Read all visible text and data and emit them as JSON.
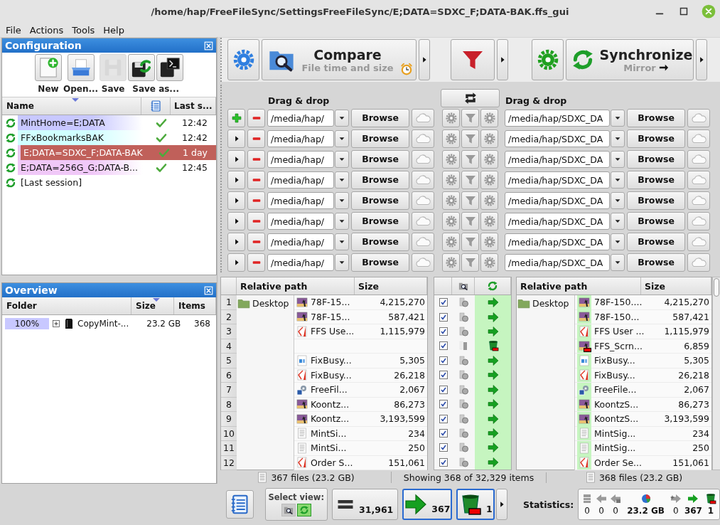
{
  "window": {
    "title": "/home/hap/FreeFileSync/SettingsFreeFileSync/E;DATA=SDXC_F;DATA-BAK.ffs_gui"
  },
  "menu": [
    "File",
    "Actions",
    "Tools",
    "Help"
  ],
  "configuration": {
    "title": "Configuration",
    "toolbar": [
      {
        "label": "New",
        "buttons": [
          {
            "kind": "new",
            "disabled": false
          }
        ]
      },
      {
        "label": "Open...",
        "buttons": [
          {
            "kind": "open",
            "disabled": false
          }
        ]
      },
      {
        "label": "Save",
        "buttons": [
          {
            "kind": "save",
            "disabled": true
          }
        ]
      },
      {
        "label": "Save as...",
        "buttons": [
          {
            "kind": "save-as",
            "disabled": false
          },
          {
            "kind": "save-batch",
            "disabled": false
          }
        ]
      }
    ],
    "columns": {
      "name": "Name",
      "last_sync": "Last s..."
    },
    "rows": [
      {
        "name": "MintHome=E;DATA",
        "ok": true,
        "last_sync": "12:42",
        "color": "#c8c8ff",
        "selected": false
      },
      {
        "name": "FFxBookmarksBAK",
        "ok": true,
        "last_sync": "12:42",
        "color": "#d0ffff",
        "selected": false
      },
      {
        "name": "E;DATA=SDXC_F;DATA-BAK",
        "ok": true,
        "last_sync": "1 day",
        "color": "#e8c8f0",
        "selected": true
      },
      {
        "name": "E;DATA=256G_G;DATA-B...",
        "ok": true,
        "last_sync": "12:45",
        "color": "#f0c8f8",
        "selected": false
      },
      {
        "name": "[Last session]",
        "ok": false,
        "selected": false
      }
    ]
  },
  "overview": {
    "title": "Overview",
    "columns": [
      "Folder",
      "Size",
      "Items"
    ],
    "rows": [
      {
        "percent": "100%",
        "level": 1,
        "expanded": false,
        "name": "CopyMint-...",
        "size": "23.2 GB",
        "items": "368"
      }
    ]
  },
  "toolbar": {
    "compare": {
      "title": "Compare",
      "subtitle": "File time and size"
    },
    "synchronize": {
      "title": "Synchronize",
      "subtitle": "Mirror"
    }
  },
  "folder_pairs": {
    "left_label": "Drag & drop",
    "right_label": "Drag & drop",
    "rows": [
      {
        "kind": "main",
        "left_path": "/media/hap/",
        "left_browse": "Browse",
        "right_path": "/media/hap/SDXC_DA",
        "right_browse": "Browse"
      },
      {
        "kind": "extra",
        "left_path": "/media/hap/",
        "left_browse": "Browse",
        "right_path": "/media/hap/SDXC_DA",
        "right_browse": "Browse"
      },
      {
        "kind": "extra",
        "left_path": "/media/hap/",
        "left_browse": "Browse",
        "right_path": "/media/hap/SDXC_DA",
        "right_browse": "Browse"
      },
      {
        "kind": "extra",
        "left_path": "/media/hap/",
        "left_browse": "Browse",
        "right_path": "/media/hap/SDXC_DA",
        "right_browse": "Browse"
      },
      {
        "kind": "extra",
        "left_path": "/media/hap/",
        "left_browse": "Browse",
        "right_path": "/media/hap/SDXC_DA",
        "right_browse": "Browse"
      },
      {
        "kind": "extra",
        "left_path": "/media/hap/",
        "left_browse": "Browse",
        "right_path": "/media/hap/SDXC_DA",
        "right_browse": "Browse"
      },
      {
        "kind": "extra",
        "left_path": "/media/hap/",
        "left_browse": "Browse",
        "right_path": "/media/hap/SDXC_DA",
        "right_browse": "Browse"
      },
      {
        "kind": "extra",
        "left_path": "/media/hap/",
        "left_browse": "Browse",
        "right_path": "/media/hap/SDXC_DA",
        "right_browse": "Browse"
      }
    ]
  },
  "grid": {
    "left_columns": [
      "Relative path",
      "Size"
    ],
    "right_columns": [
      "Relative path",
      "Size"
    ],
    "left_folder": "Desktop",
    "right_folder": "Desktop",
    "rows": [
      {
        "num": "1",
        "left": {
          "kind": "image",
          "name": "78F-15...",
          "size": "4,215,270"
        },
        "checked": true,
        "category": {
          "kind": "different"
        },
        "action": {
          "kind": "copy-right"
        },
        "right": {
          "kind": "image",
          "name": "78F-150....",
          "size": "4,215,270"
        }
      },
      {
        "num": "2",
        "left": {
          "kind": "image",
          "name": "78F-15...",
          "size": "587,421"
        },
        "checked": true,
        "category": {
          "kind": "different"
        },
        "action": {
          "kind": "copy-right"
        },
        "right": {
          "kind": "image",
          "name": "78F-150...",
          "size": "587,421"
        }
      },
      {
        "num": "3",
        "left": {
          "kind": "pdf",
          "name": "FFS Use...",
          "size": "1,115,979"
        },
        "checked": true,
        "category": {
          "kind": "different"
        },
        "action": {
          "kind": "copy-right"
        },
        "right": {
          "kind": "pdf",
          "name": "FFS User ...",
          "size": "1,115,979"
        }
      },
      {
        "num": "4",
        "checked": true,
        "category": {
          "kind": "right-only"
        },
        "action": {
          "kind": "delete-right"
        },
        "right": {
          "kind": "image",
          "name": "FFS_Scrn...",
          "size": "6,859"
        }
      },
      {
        "num": "5",
        "left": {
          "kind": "doc",
          "name": "FixBusy...",
          "size": "5,305"
        },
        "checked": true,
        "category": {
          "kind": "different"
        },
        "action": {
          "kind": "copy-right"
        },
        "right": {
          "kind": "doc",
          "name": "FixBusy...",
          "size": "5,305"
        }
      },
      {
        "num": "6",
        "left": {
          "kind": "pdf",
          "name": "FixBusy...",
          "size": "26,218"
        },
        "checked": true,
        "category": {
          "kind": "different"
        },
        "action": {
          "kind": "copy-right"
        },
        "right": {
          "kind": "pdf",
          "name": "FixBusy...",
          "size": "26,218"
        }
      },
      {
        "num": "7",
        "left": {
          "kind": "link",
          "name": "FreeFil...",
          "size": "2,067"
        },
        "checked": true,
        "category": {
          "kind": "different"
        },
        "action": {
          "kind": "copy-right"
        },
        "right": {
          "kind": "link",
          "name": "FreeFile...",
          "size": "2,067"
        }
      },
      {
        "num": "8",
        "left": {
          "kind": "image",
          "name": "Koontz...",
          "size": "86,273"
        },
        "checked": true,
        "category": {
          "kind": "different"
        },
        "action": {
          "kind": "copy-right"
        },
        "right": {
          "kind": "image",
          "name": "KoontzS...",
          "size": "86,273"
        }
      },
      {
        "num": "9",
        "left": {
          "kind": "image",
          "name": "Koontz...",
          "size": "3,193,599"
        },
        "checked": true,
        "category": {
          "kind": "different"
        },
        "action": {
          "kind": "copy-right"
        },
        "right": {
          "kind": "image",
          "name": "KoontzS...",
          "size": "3,193,599"
        }
      },
      {
        "num": "10",
        "left": {
          "kind": "text",
          "name": "MintSi...",
          "size": "234"
        },
        "checked": true,
        "category": {
          "kind": "different"
        },
        "action": {
          "kind": "copy-right"
        },
        "right": {
          "kind": "text",
          "name": "MintSig...",
          "size": "234"
        }
      },
      {
        "num": "11",
        "left": {
          "kind": "text",
          "name": "MintSi...",
          "size": "250"
        },
        "checked": true,
        "category": {
          "kind": "different"
        },
        "action": {
          "kind": "copy-right"
        },
        "right": {
          "kind": "text",
          "name": "MintSig...",
          "size": "250"
        }
      },
      {
        "num": "12",
        "left": {
          "kind": "pdf",
          "name": "Order S...",
          "size": "151,061"
        },
        "checked": true,
        "category": {
          "kind": "different"
        },
        "action": {
          "kind": "copy-right"
        },
        "right": {
          "kind": "pdf",
          "name": "Order Se...",
          "size": "151,061"
        }
      }
    ]
  },
  "status_bar": {
    "left": "367 files (23.2 GB)",
    "center": "Showing 368 of 32,329 items",
    "right": "368 files (23.2 GB)"
  },
  "bottom_bar": {
    "view_label": "Select view:",
    "view_modes": [
      {
        "kind": "compare",
        "selected": false
      },
      {
        "kind": "sync",
        "selected": true
      }
    ],
    "filters": [
      {
        "kind": "equal",
        "count": "31,961",
        "selected": false
      },
      {
        "kind": "copy-right",
        "count": "367",
        "selected": true
      },
      {
        "kind": "delete-right",
        "count": "1",
        "selected": true
      }
    ],
    "statistics_label": "Statistics:",
    "statistics": [
      {
        "kind": "create-left",
        "value": "0",
        "active": false
      },
      {
        "kind": "update-left",
        "value": "0",
        "active": false
      },
      {
        "kind": "delete-left",
        "value": "0",
        "active": false
      },
      {
        "kind": "pie",
        "value": "23.2 GB",
        "active": true
      },
      {
        "kind": "create-right",
        "value": "0",
        "active": false
      },
      {
        "kind": "update-right",
        "value": "367",
        "active": true
      },
      {
        "kind": "delete-right",
        "value": "1",
        "active": true
      }
    ]
  }
}
